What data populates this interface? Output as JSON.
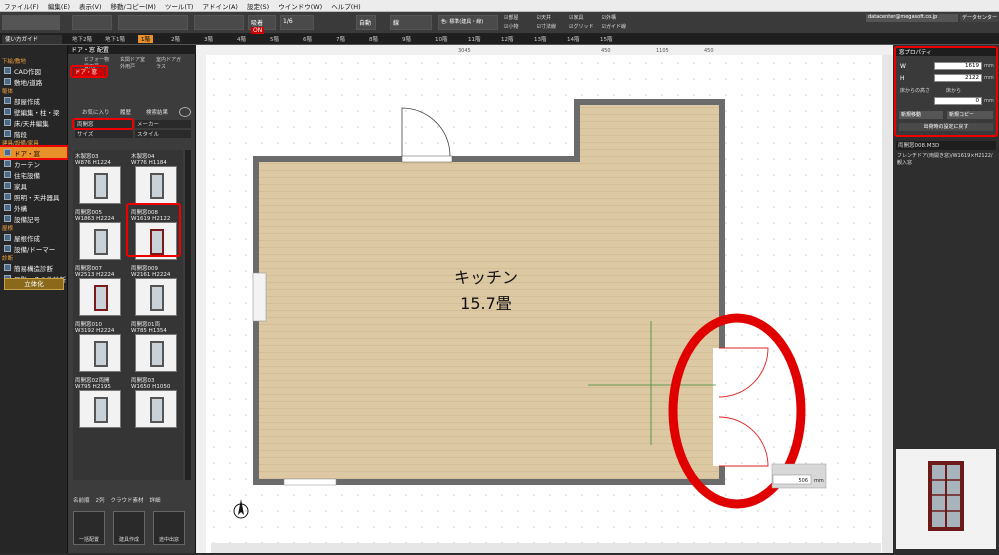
{
  "menu": [
    "ファイル(F)",
    "編集(E)",
    "表示(V)",
    "移動/コピー(M)",
    "ツール(T)",
    "アドイン(A)",
    "設定(S)",
    "ウインドウ(W)",
    "ヘルプ(H)"
  ],
  "toolbar": {
    "view_label": "自動",
    "line_label": "線",
    "color_label": "色: 標準(建具・線)",
    "zoom_label": "1/6",
    "checks": [
      "部屋",
      "天井",
      "家具",
      "外構",
      "小物",
      "寸法線",
      "グリッド",
      "ガイド線"
    ],
    "email": "datacenter@megasoft.co.jp",
    "datacenter": "データセンター",
    "snap_on": "ON"
  },
  "floors": [
    "地下2階",
    "地下1階",
    "1階",
    "2階",
    "3階",
    "4階",
    "5階",
    "6階",
    "7階",
    "8階",
    "9階",
    "10階",
    "11階",
    "12階",
    "13階",
    "14階",
    "15階"
  ],
  "leftnav": {
    "guide": "使い方ガイド",
    "sections": [
      {
        "header": "下絵/敷地",
        "items": [
          "CAD作図",
          "敷地/道路"
        ]
      },
      {
        "header": "躯体",
        "items": [
          "部屋作成",
          "壁編集・柱・梁",
          "床/天井編集",
          "階段"
        ]
      },
      {
        "header": "建具/設備/家具",
        "items": [
          "ドア・窓",
          "カーテン",
          "住宅設備",
          "家具",
          "照明・天井器具",
          "外構",
          "設備記号"
        ]
      },
      {
        "header": "屋根",
        "items": [
          "屋根作成",
          "設備/ドーマー"
        ]
      },
      {
        "header": "診断",
        "items": [
          "簡易構造診断",
          "日影・その他診断"
        ]
      }
    ],
    "button_3d": "立体化"
  },
  "catalog": {
    "title": "ドア・窓 配置",
    "tabs": [
      "ドア",
      "ビフォー物置用戸",
      "玄関ドア室外用戸",
      "室内ドアガラス"
    ],
    "active_tab": "ドア・窓",
    "tabs2": [
      "お気に入り",
      "履歴",
      "検索結果"
    ],
    "filter1": "種類",
    "filter1_value": "両開窓",
    "filter2": "メーカー",
    "filter3": "サイズ",
    "filter4": "スタイル",
    "items": [
      {
        "name": "木製窓03",
        "size": "W876 H1224"
      },
      {
        "name": "木製窓04",
        "size": "W776 H1184"
      },
      {
        "name": "両開窓005",
        "size": "W1863 H2224"
      },
      {
        "name": "両開窓008",
        "size": "W1619 H2122"
      },
      {
        "name": "両開窓007",
        "size": "W2513 H2224"
      },
      {
        "name": "両開窓009",
        "size": "W2161 H2224"
      },
      {
        "name": "両開窓010",
        "size": "W3192 H2224"
      },
      {
        "name": "両開窓01両",
        "size": "W785 H1354"
      },
      {
        "name": "両開窓02両開",
        "size": "W795 H2195"
      },
      {
        "name": "両開窓03",
        "size": "W1650 H1050"
      }
    ],
    "footer": {
      "name_label": "名前順",
      "count": "2列",
      "check1": "クラウド素材",
      "check2": "詳細"
    },
    "bottom_buttons": [
      "一括配置",
      "建具作成",
      "途中出窓"
    ]
  },
  "canvas": {
    "room_name": "キッチン",
    "room_area": "15.7畳",
    "ruler_labels": [
      "3045",
      "450",
      "1105",
      "450"
    ],
    "dim_value": "506",
    "dim_unit": "mm"
  },
  "props": {
    "title": "窓プロパティ",
    "w_label": "W",
    "w_value": "1619",
    "h_label": "H",
    "h_value": "2122",
    "unit": "mm",
    "floor_height_label": "床からの高さ",
    "floor_height_sub": "床から",
    "floor_height_value": "0",
    "mode1": "新規移動",
    "mode2": "新規コピー",
    "restore": "出荷時の設定に戻す",
    "file": "両開窓008.M3D",
    "desc": "フレンチドア(両開き窓)/W1619×H2122/観入窓"
  },
  "colors": {
    "accent": "#e8902a",
    "red": "#e00000",
    "floor": "#dcc8a2",
    "wall": "#6b6b6b"
  }
}
